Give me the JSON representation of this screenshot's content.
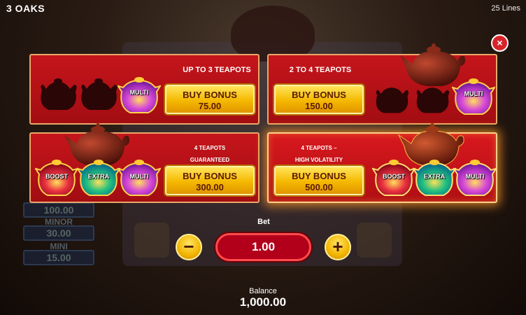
{
  "header": {
    "game_title": "3 OAKS",
    "lines": "25 Lines"
  },
  "close_icon": "×",
  "background_jackpots": [
    {
      "label": "",
      "value": "100.00"
    },
    {
      "label": "MINOR",
      "value": "30.00"
    },
    {
      "label": "MINI",
      "value": "15.00"
    }
  ],
  "cards": [
    {
      "title_lines": [
        "UP TO 3 TEAPOTS"
      ],
      "button_line1": "BUY BONUS",
      "button_line2": "75.00",
      "pots": [
        "silhouette",
        "silhouette",
        "MULTI"
      ]
    },
    {
      "title_lines": [
        "2 TO 4 TEAPOTS"
      ],
      "button_line1": "BUY BONUS",
      "button_line2": "150.00",
      "pots": [
        "silhouette",
        "silhouette",
        "MULTI"
      ]
    },
    {
      "title_lines": [
        "4 TEAPOTS",
        "GUARANTEED"
      ],
      "button_line1": "BUY BONUS",
      "button_line2": "300.00",
      "pots": [
        "BOOST",
        "EXTRA",
        "MULTI"
      ]
    },
    {
      "title_lines": [
        "4 TEAPOTS –",
        "HIGH VOLATILITY"
      ],
      "button_line1": "BUY BONUS",
      "button_line2": "500.00",
      "pots": [
        "BOOST",
        "EXTRA",
        "MULTI"
      ]
    }
  ],
  "bet": {
    "label": "Bet",
    "value": "1.00",
    "minus": "−",
    "plus": "+"
  },
  "balance": {
    "label": "Balance",
    "value": "1,000.00"
  },
  "colors": {
    "card_red": "#c5151b",
    "button_gold": "#f5b800",
    "close_red": "#d8232a",
    "boost": "#e8203a",
    "extra": "#20c080",
    "multi": "#b040d0"
  }
}
